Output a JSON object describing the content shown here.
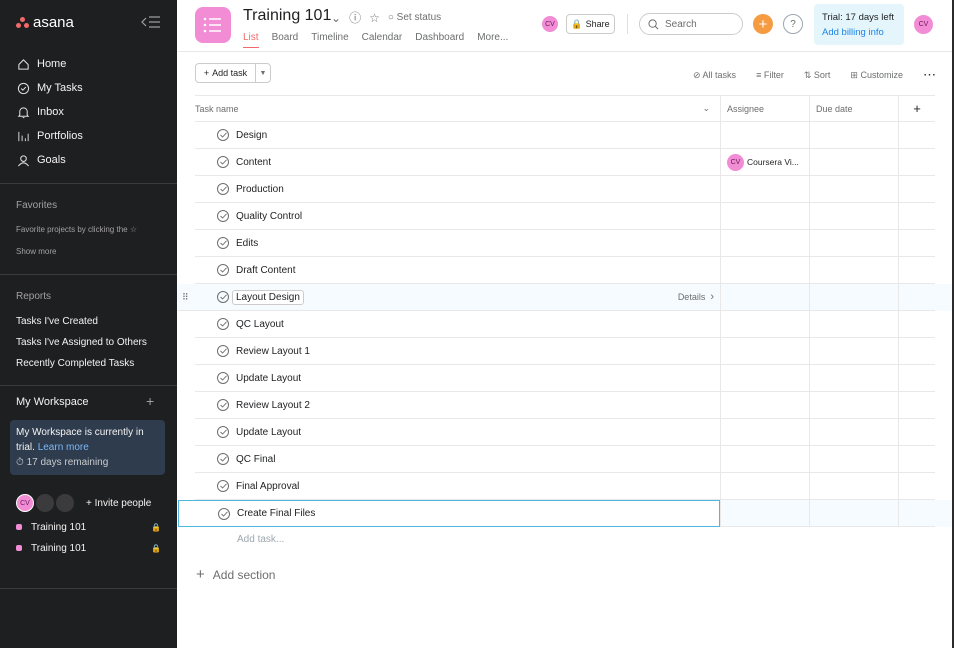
{
  "sidebar": {
    "logo": "asana",
    "nav": [
      {
        "label": "Home",
        "icon": "home-icon"
      },
      {
        "label": "My Tasks",
        "icon": "check-circle-icon"
      },
      {
        "label": "Inbox",
        "icon": "bell-icon"
      },
      {
        "label": "Portfolios",
        "icon": "bar-chart-icon"
      },
      {
        "label": "Goals",
        "icon": "person-icon"
      }
    ],
    "favorites": {
      "label": "Favorites",
      "hint": "Favorite projects by clicking the ☆",
      "show_more": "Show more"
    },
    "reports": {
      "label": "Reports",
      "items": [
        "Tasks I've Created",
        "Tasks I've Assigned to Others",
        "Recently Completed Tasks"
      ]
    },
    "workspace": {
      "title": "My Workspace",
      "trial_line1": "My Workspace is currently in",
      "trial_line2": "trial.",
      "learn_more": "Learn more",
      "remaining": "17 days remaining",
      "avatar_initials": "CV",
      "invite": "Invite people",
      "projects": [
        "Training 101",
        "Training 101"
      ]
    }
  },
  "header": {
    "project_title": "Training 101",
    "set_status": "Set status",
    "tabs": [
      "List",
      "Board",
      "Timeline",
      "Calendar",
      "Dashboard",
      "More..."
    ],
    "avatar_initials": "CV",
    "share": "Share",
    "search_placeholder": "Search",
    "trial_text": "Trial: 17 days left",
    "billing_link": "Add billing info",
    "user_initials": "CV"
  },
  "toolbar": {
    "add_task": "Add task",
    "all_tasks": "All tasks",
    "filter": "Filter",
    "sort": "Sort",
    "customize": "Customize"
  },
  "table": {
    "columns": {
      "name": "Task name",
      "assignee": "Assignee",
      "due": "Due date"
    },
    "tasks": [
      {
        "name": "Design",
        "assignee": ""
      },
      {
        "name": "Content",
        "assignee": "Coursera Vi...",
        "assignee_initials": "CV"
      },
      {
        "name": "Production",
        "assignee": ""
      },
      {
        "name": "Quality Control",
        "assignee": ""
      },
      {
        "name": "Edits",
        "assignee": ""
      },
      {
        "name": "Draft Content",
        "assignee": ""
      },
      {
        "name": "Layout Design",
        "assignee": "",
        "details": "Details"
      },
      {
        "name": "QC Layout",
        "assignee": ""
      },
      {
        "name": "Review Layout 1",
        "assignee": ""
      },
      {
        "name": "Update Layout",
        "assignee": ""
      },
      {
        "name": "Review Layout 2",
        "assignee": ""
      },
      {
        "name": "Update Layout",
        "assignee": ""
      },
      {
        "name": "QC Final",
        "assignee": ""
      },
      {
        "name": "Final Approval",
        "assignee": ""
      },
      {
        "name": "Create Final Files",
        "assignee": ""
      }
    ],
    "add_task_row": "Add task...",
    "add_section": "Add section"
  },
  "colors": {
    "accent": "#f06a6a",
    "project": "#f18cd5",
    "sidebar": "#1e1f21"
  }
}
